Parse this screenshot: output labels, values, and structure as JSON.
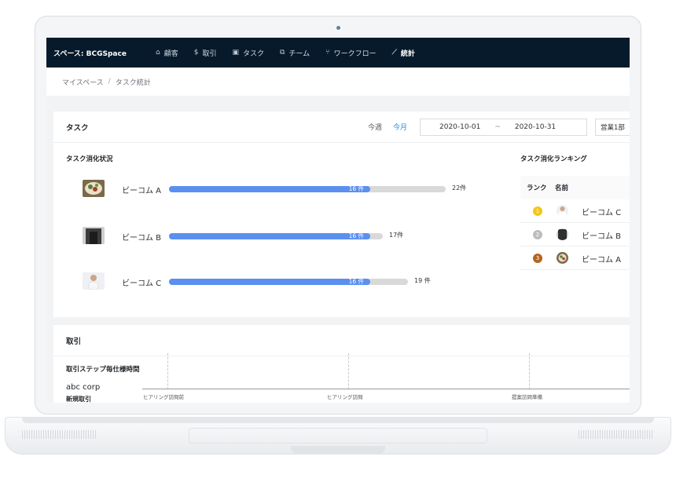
{
  "app": {
    "space_label": "スペース: BCGSpace"
  },
  "nav": {
    "items": [
      {
        "icon": "home-icon",
        "glyph": "⌂",
        "label": "顧客",
        "active": false
      },
      {
        "icon": "currency-icon",
        "glyph": "$",
        "label": "取引",
        "active": false
      },
      {
        "icon": "calendar-icon",
        "glyph": "▣",
        "label": "タスク",
        "active": false
      },
      {
        "icon": "team-icon",
        "glyph": "⧉",
        "label": "チーム",
        "active": false
      },
      {
        "icon": "workflow-icon",
        "glyph": "⑂",
        "label": "ワークフロー",
        "active": false
      },
      {
        "icon": "chart-icon",
        "glyph": "⟋",
        "label": "統計",
        "active": true
      }
    ]
  },
  "breadcrumb": {
    "root": "マイスペース",
    "sep": "/",
    "current": "タスク統計"
  },
  "task_card": {
    "title": "タスク",
    "period_week": "今週",
    "period_month": "今月",
    "date_start": "2020-10-01",
    "date_sep": "~",
    "date_end": "2020-10-31",
    "department": "営業1部",
    "progress_title": "タスク消化状況",
    "progress_rows": [
      {
        "name": "ビーコム A",
        "done_label": "16 件",
        "total_label": "22件",
        "done": 16,
        "total": 22,
        "thumb": "food-photo"
      },
      {
        "name": "ビーコム B",
        "done_label": "16 件",
        "total_label": "17件",
        "done": 16,
        "total": 17,
        "thumb": "door-photo"
      },
      {
        "name": "ビーコム C",
        "done_label": "16 件",
        "total_label": "19 件",
        "done": 16,
        "total": 19,
        "thumb": "person-photo"
      }
    ],
    "ranking_title": "タスク消化ランキング",
    "ranking_col_rank": "ランク",
    "ranking_col_name": "名前",
    "ranking_rows": [
      {
        "rank": "1",
        "medal_color": "#f5c518",
        "name": "ビーコム C"
      },
      {
        "rank": "2",
        "medal_color": "#bdbdbd",
        "name": "ビーコム B"
      },
      {
        "rank": "3",
        "medal_color": "#b5651d",
        "name": "ビーコム A"
      }
    ]
  },
  "deal_card": {
    "title": "取引",
    "chart_title": "取引ステップ毎仕様時間",
    "company": "abc corp",
    "deal_type": "新規取引",
    "stages": [
      "ヒアリング訪問前",
      "ヒアリング訪問",
      "提案訪問準備"
    ]
  },
  "colors": {
    "nav_bg": "#061a2b",
    "accent": "#1f8ceb",
    "bar_fill": "#5b8ff0",
    "bar_track": "#d9d9d9"
  }
}
